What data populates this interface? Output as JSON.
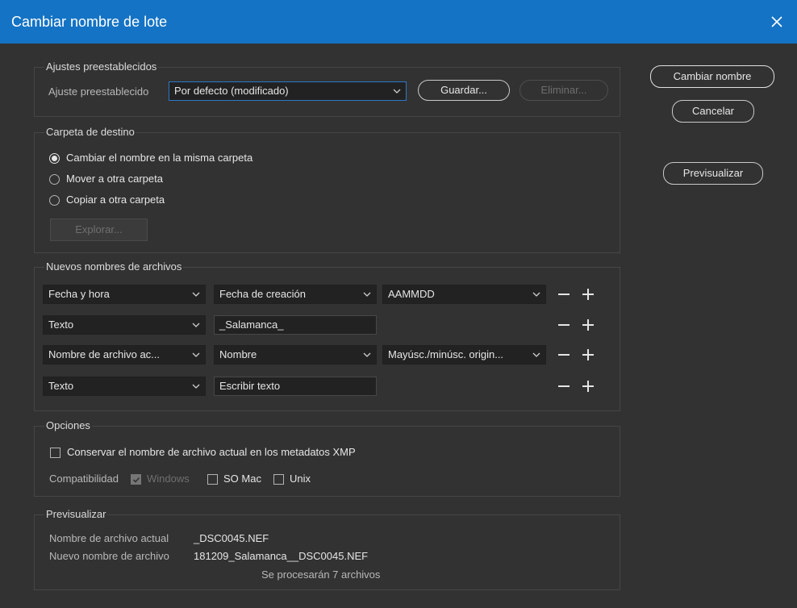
{
  "window": {
    "title": "Cambiar nombre de lote",
    "close_icon": "close-icon"
  },
  "actions": {
    "rename_label": "Cambiar nombre",
    "cancel_label": "Cancelar",
    "preview_label": "Previsualizar"
  },
  "presets": {
    "legend": "Ajustes preestablecidos",
    "label": "Ajuste preestablecido",
    "selected": "Por defecto (modificado)",
    "save_label": "Guardar...",
    "delete_label": "Eliminar..."
  },
  "destination": {
    "legend": "Carpeta de destino",
    "options": [
      {
        "label": "Cambiar el nombre en la misma carpeta",
        "selected": true
      },
      {
        "label": "Mover a otra carpeta",
        "selected": false
      },
      {
        "label": "Copiar a otra carpeta",
        "selected": false
      }
    ],
    "browse_label": "Explorar..."
  },
  "new_names": {
    "legend": "Nuevos nombres de archivos",
    "rows": [
      {
        "type": "Fecha y hora",
        "second": "Fecha de creación",
        "second_kind": "select",
        "third": "AAMMDD"
      },
      {
        "type": "Texto",
        "second": "_Salamanca_",
        "second_kind": "input",
        "third": null
      },
      {
        "type": "Nombre de archivo ac...",
        "second": "Nombre",
        "second_kind": "select",
        "third": "Mayúsc./minúsc. origin..."
      },
      {
        "type": "Texto",
        "second": "Escribir texto",
        "second_kind": "input",
        "third": null
      }
    ],
    "remove_icon": "minus-icon",
    "add_icon": "plus-icon"
  },
  "options": {
    "legend": "Opciones",
    "preserve_label": "Conservar el nombre de archivo actual en los metadatos XMP",
    "preserve_checked": false,
    "compat_label": "Compatibilidad",
    "windows_label": "Windows",
    "windows_checked": true,
    "mac_label": "SO Mac",
    "mac_checked": false,
    "unix_label": "Unix",
    "unix_checked": false
  },
  "preview": {
    "legend": "Previsualizar",
    "current_label": "Nombre de archivo actual",
    "current_value": "_DSC0045.NEF",
    "new_label": "Nuevo nombre de archivo",
    "new_value": "181209_Salamanca__DSC0045.NEF",
    "count_text": "Se procesarán 7 archivos"
  },
  "colors": {
    "titlebar": "#1473c4",
    "background": "#323232",
    "focus": "#2c78c7"
  }
}
